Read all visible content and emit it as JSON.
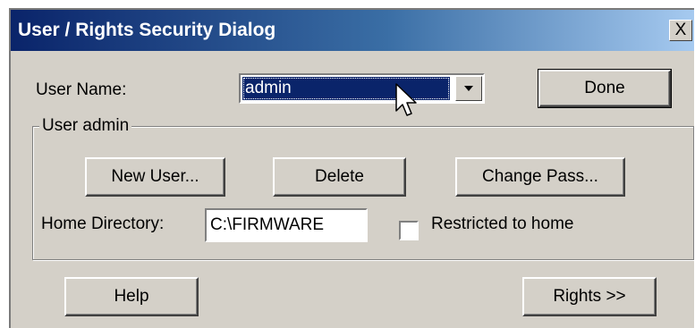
{
  "window": {
    "title": "User / Rights Security Dialog",
    "close_label": "X"
  },
  "user_name": {
    "label": "User Name:",
    "selected": "admin"
  },
  "buttons": {
    "done": "Done",
    "new_user": "New User...",
    "delete": "Delete",
    "change_pass": "Change Pass...",
    "help": "Help",
    "rights": "Rights >>"
  },
  "group": {
    "legend": "User admin"
  },
  "home_directory": {
    "label": "Home Directory:",
    "value": "C:\\FIRMWARE"
  },
  "restricted": {
    "label": "Restricted to home",
    "checked": false
  },
  "icons": {
    "combo_arrow": "chevron-down-icon",
    "pointer": "mouse-pointer-icon"
  },
  "colors": {
    "title_start": "#0a246a",
    "title_end": "#a6caf0",
    "face": "#d4d0c8",
    "selection": "#0a246a"
  }
}
